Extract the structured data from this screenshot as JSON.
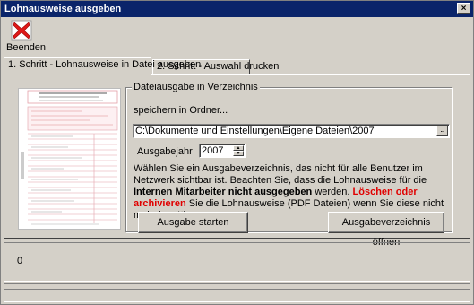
{
  "window": {
    "title": "Lohnausweise ausgeben",
    "close_glyph": "×"
  },
  "toolbar": {
    "exit_label": "Beenden",
    "exit_icon": "red-x-icon"
  },
  "tabs": [
    {
      "label": "1. Schritt - Lohnausweise in Datei ausgeben",
      "active": true
    },
    {
      "label": "2. Schritt - Auswahl drucken",
      "active": false
    }
  ],
  "group": {
    "title": "Dateiausgabe in Verzeichnis",
    "save_in_label": "speichern in Ordner...",
    "path_value": "C:\\Dokumente und Einstellungen\\Eigene Dateien\\2007",
    "browse_label": "...",
    "year_label": "Ausgabejahr",
    "year_value": "2007",
    "info": {
      "part1": "Wählen Sie ein Ausgabeverzeichnis, das nicht für alle Benutzer im Netzwerk sichtbar ist. Beachten Sie, dass die Lohnausweise für die ",
      "bold1": "Internen Mitarbeiter nicht ausgegeben",
      "part2": " werden. ",
      "red1": "Löschen oder archivieren",
      "part3": " Sie die Lohnausweise (PDF Dateien) wenn Sie diese nicht mehr benötigen."
    },
    "start_button": "Ausgabe starten",
    "open_button": "Ausgabeverzeichnis öffnen"
  },
  "status": {
    "value": "0"
  },
  "colors": {
    "titlebar": "#0a246a",
    "warning_red": "#e00000",
    "face": "#d4d0c8"
  }
}
